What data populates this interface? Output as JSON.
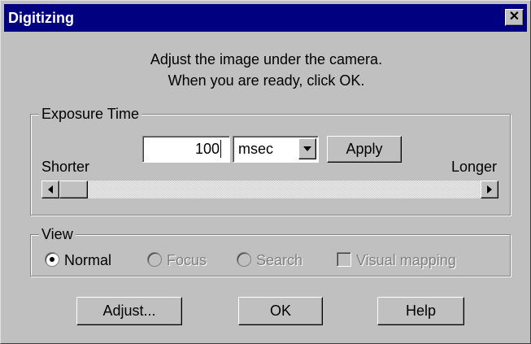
{
  "window": {
    "title": "Digitizing",
    "close_glyph": "✕"
  },
  "instructions": {
    "line1": "Adjust the image under the camera.",
    "line2": "When you are ready, click OK."
  },
  "exposure": {
    "group_label": "Exposure Time",
    "value": "100",
    "unit": "msec",
    "apply_label": "Apply",
    "shorter_label": "Shorter",
    "longer_label": "Longer",
    "slider_level": 0.0
  },
  "view": {
    "group_label": "View",
    "options": [
      {
        "label": "Normal",
        "selected": true,
        "enabled": true
      },
      {
        "label": "Focus",
        "selected": false,
        "enabled": false
      },
      {
        "label": "Search",
        "selected": false,
        "enabled": false
      }
    ],
    "visual_mapping": {
      "label": "Visual mapping",
      "checked": false,
      "enabled": false
    }
  },
  "buttons": {
    "adjust": "Adjust...",
    "ok": "OK",
    "help": "Help"
  },
  "colors": {
    "titlebar": "#000080",
    "face": "#c0c0c0",
    "disabled_text": "#808080"
  },
  "icons": {
    "close": "close-icon",
    "dropdown": "chevron-down-icon",
    "scroll_left": "arrow-left-icon",
    "scroll_right": "arrow-right-icon"
  }
}
